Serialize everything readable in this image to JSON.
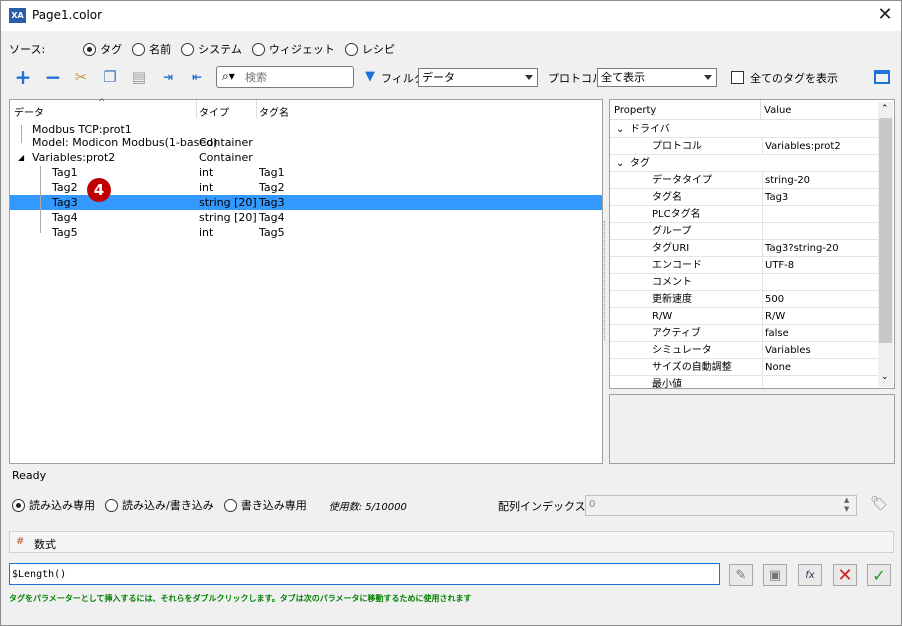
{
  "window": {
    "title": "Page1.color",
    "icon_text": "XA"
  },
  "source": {
    "label": "ソース:",
    "options": [
      {
        "label": "タグ",
        "selected": true
      },
      {
        "label": "名前",
        "selected": false
      },
      {
        "label": "システム",
        "selected": false
      },
      {
        "label": "ウィジェット",
        "selected": false
      },
      {
        "label": "レシピ",
        "selected": false
      }
    ]
  },
  "toolbar": {
    "search_placeholder": "検索",
    "filter_label": "フィルタ",
    "filter_value": "データ",
    "protocol_label": "プロトコル",
    "protocol_value": "全て表示",
    "show_all_tags_label": "全てのタグを表示"
  },
  "tree": {
    "headers": [
      "データ",
      "タイプ",
      "タグ名"
    ],
    "rows": [
      {
        "data": "Modbus TCP:prot1",
        "type": "",
        "tag": ""
      },
      {
        "data": "Model: Modicon Modbus(1-based)",
        "type": "Container",
        "tag": ""
      },
      {
        "data": "Variables:prot2",
        "type": "Container",
        "tag": ""
      },
      {
        "data": "Tag1",
        "type": "int",
        "tag": "Tag1"
      },
      {
        "data": "Tag2",
        "type": "int",
        "tag": "Tag2"
      },
      {
        "data": "Tag3",
        "type": "string [20]",
        "tag": "Tag3"
      },
      {
        "data": "Tag4",
        "type": "string [20]",
        "tag": "Tag4"
      },
      {
        "data": "Tag5",
        "type": "int",
        "tag": "Tag5"
      }
    ],
    "badge": "4"
  },
  "properties": {
    "headers": [
      "Property",
      "Value"
    ],
    "rows": [
      {
        "key": "ドライバ",
        "value": "",
        "category": true
      },
      {
        "key": "プロトコル",
        "value": "Variables:prot2",
        "category": false
      },
      {
        "key": "タグ",
        "value": "",
        "category": true
      },
      {
        "key": "データタイプ",
        "value": "string-20",
        "category": false
      },
      {
        "key": "タグ名",
        "value": "Tag3",
        "category": false
      },
      {
        "key": "PLCタグ名",
        "value": "",
        "category": false
      },
      {
        "key": "グループ",
        "value": "",
        "category": false
      },
      {
        "key": "タグURI",
        "value": "Tag3?string-20",
        "category": false
      },
      {
        "key": "エンコード",
        "value": "UTF-8",
        "category": false
      },
      {
        "key": "コメント",
        "value": "",
        "category": false
      },
      {
        "key": "更新速度",
        "value": "500",
        "category": false
      },
      {
        "key": "R/W",
        "value": "R/W",
        "category": false
      },
      {
        "key": "アクティブ",
        "value": "false",
        "category": false
      },
      {
        "key": "シミュレータ",
        "value": "Variables",
        "category": false
      },
      {
        "key": "サイズの自動調整",
        "value": "None",
        "category": false
      },
      {
        "key": "最小値",
        "value": "",
        "category": false
      }
    ]
  },
  "status": "Ready",
  "access": {
    "options": [
      {
        "label": "読み込み専用",
        "selected": true
      },
      {
        "label": "読み込み/書き込み",
        "selected": false
      },
      {
        "label": "書き込み専用",
        "selected": false
      }
    ],
    "usage": "使用数: 5/10000",
    "array_index_label": "配列インデックス:",
    "array_index_value": "0"
  },
  "formula": {
    "label": "数式",
    "value": "$Length()",
    "hint": "タグをパラメーターとして挿入するには、それらをダブルクリックします。タブは次のパラメータに移動するために使用されます"
  },
  "colors": {
    "accent": "#1e73d8",
    "selection": "#3399ff",
    "hint": "#008000",
    "cancel": "#d21e1e",
    "ok": "#1ea01e"
  }
}
